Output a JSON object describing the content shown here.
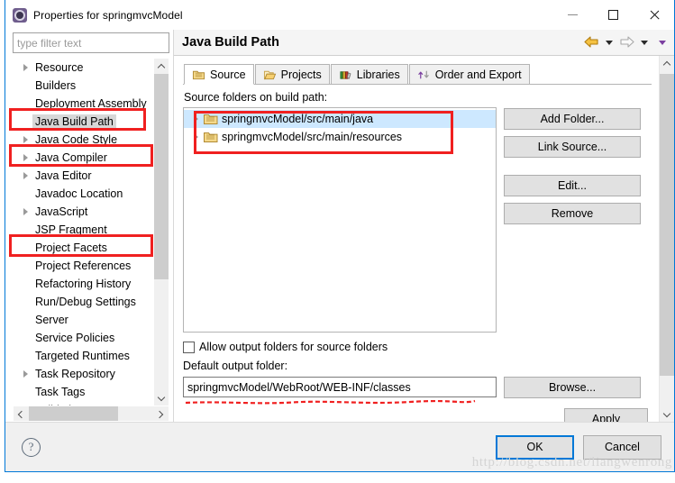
{
  "window": {
    "title": "Properties for springmvcModel",
    "icon": "properties-gear-icon",
    "minimize_label": "Minimize",
    "maximize_label": "Maximize",
    "close_label": "Close"
  },
  "sidebar": {
    "filter_placeholder": "type filter text",
    "filter_value": "",
    "items": [
      {
        "label": "Resource",
        "expandable": true,
        "selected": false
      },
      {
        "label": "Builders",
        "expandable": false,
        "selected": false
      },
      {
        "label": "Deployment Assembly",
        "expandable": false,
        "selected": false
      },
      {
        "label": "Java Build Path",
        "expandable": false,
        "selected": true
      },
      {
        "label": "Java Code Style",
        "expandable": true,
        "selected": false
      },
      {
        "label": "Java Compiler",
        "expandable": true,
        "selected": false
      },
      {
        "label": "Java Editor",
        "expandable": true,
        "selected": false
      },
      {
        "label": "Javadoc Location",
        "expandable": false,
        "selected": false
      },
      {
        "label": "JavaScript",
        "expandable": true,
        "selected": false
      },
      {
        "label": "JSP Fragment",
        "expandable": false,
        "selected": false
      },
      {
        "label": "Project Facets",
        "expandable": false,
        "selected": false
      },
      {
        "label": "Project References",
        "expandable": false,
        "selected": false
      },
      {
        "label": "Refactoring History",
        "expandable": false,
        "selected": false
      },
      {
        "label": "Run/Debug Settings",
        "expandable": false,
        "selected": false
      },
      {
        "label": "Server",
        "expandable": false,
        "selected": false
      },
      {
        "label": "Service Policies",
        "expandable": false,
        "selected": false
      },
      {
        "label": "Targeted Runtimes",
        "expandable": false,
        "selected": false
      },
      {
        "label": "Task Repository",
        "expandable": true,
        "selected": false
      },
      {
        "label": "Task Tags",
        "expandable": false,
        "selected": false
      },
      {
        "label": "Validation",
        "expandable": true,
        "selected": false
      }
    ]
  },
  "main": {
    "page_title": "Java Build Path",
    "nav": {
      "back_icon": "back-arrow-icon",
      "back_menu_icon": "chevron-down-icon",
      "forward_icon": "forward-arrow-icon",
      "forward_menu_icon": "chevron-down-icon",
      "view_menu_icon": "chevron-down-icon"
    },
    "tabs": [
      {
        "label": "Source",
        "icon": "source-folder-icon",
        "active": true
      },
      {
        "label": "Projects",
        "icon": "projects-folder-icon",
        "active": false
      },
      {
        "label": "Libraries",
        "icon": "libraries-books-icon",
        "active": false
      },
      {
        "label": "Order and Export",
        "icon": "order-export-icon",
        "active": false
      }
    ],
    "source": {
      "list_label": "Source folders on build path:",
      "entries": [
        {
          "path": "springmvcModel/src/main/java",
          "icon": "package-folder-icon",
          "selected": true
        },
        {
          "path": "springmvcModel/src/main/resources",
          "icon": "package-folder-icon",
          "selected": false
        }
      ],
      "buttons": [
        {
          "label": "Add Folder..."
        },
        {
          "label": "Link Source..."
        },
        {
          "label": "Edit..."
        },
        {
          "label": "Remove"
        }
      ],
      "allow_output_checkbox": {
        "label": "Allow output folders for source folders",
        "checked": false
      },
      "default_output_label": "Default output folder:",
      "default_output_value": "springmvcModel/WebRoot/WEB-INF/classes",
      "browse_label": "Browse..."
    },
    "apply_label": "Apply"
  },
  "footer": {
    "help_icon": "help-question-icon",
    "ok_label": "OK",
    "cancel_label": "Cancel",
    "watermark": "http://blog.csdn.net/liangwenrong"
  },
  "annotations": {
    "color": "#f02020",
    "boxes": [
      {
        "name": "java-build-path-highlight"
      },
      {
        "name": "java-compiler-highlight"
      },
      {
        "name": "project-facets-highlight"
      },
      {
        "name": "source-folders-highlight"
      }
    ],
    "underline": {
      "name": "default-output-underline",
      "color": "#f02020"
    }
  }
}
